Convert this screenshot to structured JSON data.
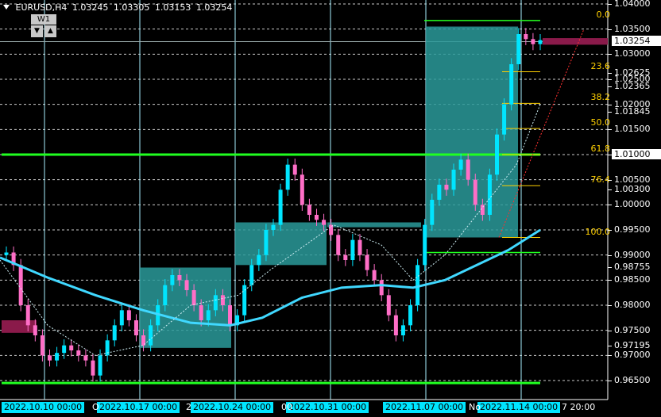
{
  "header": {
    "symbol": "EURUSD,H4",
    "open": "1.03245",
    "high": "1.03305",
    "low": "1.03153",
    "close": "1.03254"
  },
  "timeframe": {
    "label": "W1",
    "down": "▼",
    "up": "▲"
  },
  "price_axis": {
    "ticks": [
      "1.04000",
      "1.03500",
      "1.03000",
      "1.02625",
      "1.02500",
      "1.02365",
      "1.02000",
      "1.01845",
      "1.01500",
      "1.01000",
      "1.00500",
      "1.00300",
      "1.00000",
      "0.99500",
      "0.99000",
      "0.98755",
      "0.98500",
      "0.98000",
      "0.97500",
      "0.97195",
      "0.97000",
      "0.96500"
    ],
    "current_price": "1.03254"
  },
  "fibonacci": [
    "0.0",
    "23.6",
    "38.2",
    "50.0",
    "61.8",
    "76.4",
    "100.0"
  ],
  "time_axis": {
    "tagged": [
      "2022.10.10 00:00",
      "2022.10.17 00:00",
      "2022.10.24 00:00",
      "2022.10.31 00:00",
      "2022.11.07 00:00",
      "2022.11.14 00:00"
    ],
    "fragments": [
      "O",
      "2",
      "00",
      "No",
      "7 20:00"
    ]
  },
  "colors": {
    "background": "#000000",
    "bull": "#00e5ff",
    "bear": "#ff6ec7",
    "ma": "#40d8ff",
    "grid": "#ffffff",
    "fibo": "#ffd000",
    "green_line": "#20ff20",
    "zone": "#2a9a9a",
    "zone_red": "#8a1a4a"
  }
}
